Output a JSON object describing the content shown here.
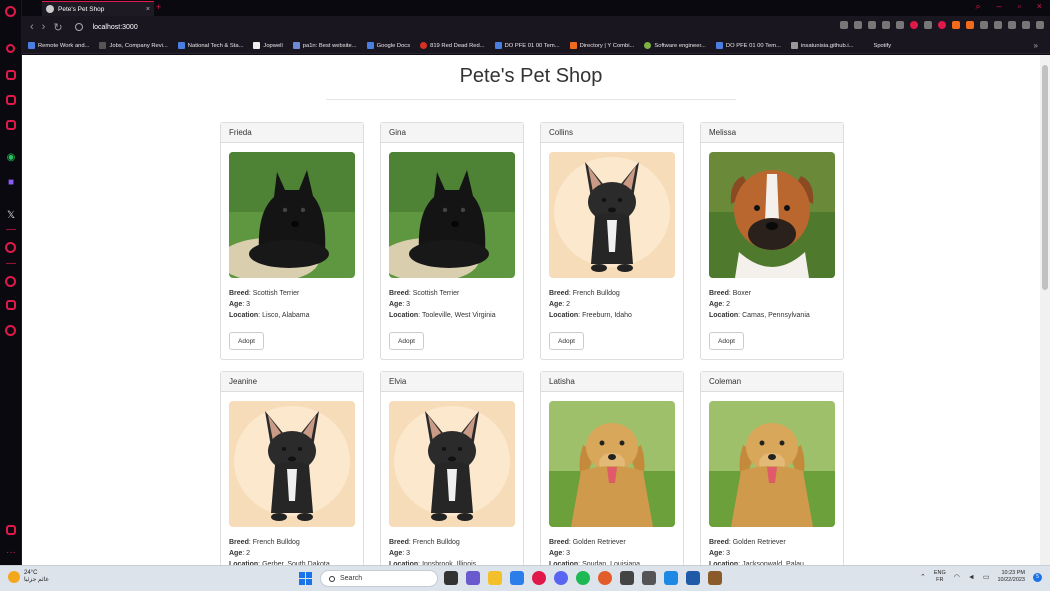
{
  "browser": {
    "tab_title": "Pete's Pet Shop",
    "url": "localhost:3000",
    "bookmarks": [
      "Remote Work and...",
      "Jobs, Company Revi...",
      "National Tech & Sta...",
      "Jopwell",
      "pa1n: Best website...",
      "Google Docs",
      "819 Red Dead Red...",
      "DO PFE 01 00 Tem...",
      "Directory | Y Combi...",
      "Software engineer...",
      "DO PFE 01 00 Tem...",
      "insatunisia.github.i...",
      "Spotify"
    ]
  },
  "page": {
    "title": "Pete's Pet Shop",
    "labels": {
      "breed": "Breed",
      "age": "Age",
      "location": "Location",
      "adopt": "Adopt"
    }
  },
  "pets": [
    {
      "name": "Frieda",
      "breed": "Scottish Terrier",
      "age": "3",
      "location": "Lisco, Alabama",
      "photo": "scottish-terrier"
    },
    {
      "name": "Gina",
      "breed": "Scottish Terrier",
      "age": "3",
      "location": "Tooleville, West Virginia",
      "photo": "scottish-terrier"
    },
    {
      "name": "Collins",
      "breed": "French Bulldog",
      "age": "2",
      "location": "Freeburn, Idaho",
      "photo": "french-bulldog"
    },
    {
      "name": "Melissa",
      "breed": "Boxer",
      "age": "2",
      "location": "Camas, Pennsylvania",
      "photo": "boxer"
    },
    {
      "name": "Jeanine",
      "breed": "French Bulldog",
      "age": "2",
      "location": "Gerber, South Dakota",
      "photo": "french-bulldog"
    },
    {
      "name": "Elvia",
      "breed": "French Bulldog",
      "age": "3",
      "location": "Innsbrook, Illinois",
      "photo": "french-bulldog"
    },
    {
      "name": "Latisha",
      "breed": "Golden Retriever",
      "age": "3",
      "location": "Soudan, Louisiana",
      "photo": "golden-retriever"
    },
    {
      "name": "Coleman",
      "breed": "Golden Retriever",
      "age": "3",
      "location": "Jacksonwald, Palau",
      "photo": "golden-retriever"
    }
  ],
  "taskbar": {
    "weather_temp": "24°C",
    "weather_desc": "غائم جزئيا",
    "search_placeholder": "Search",
    "lang_top": "ENG",
    "lang_bottom": "FR",
    "time": "10:23 PM",
    "date": "10/22/2023",
    "notifications": "5"
  },
  "colors": {
    "accent": "#e0194a",
    "page_bg": "#ffffff",
    "card_header": "#f5f5f5"
  }
}
